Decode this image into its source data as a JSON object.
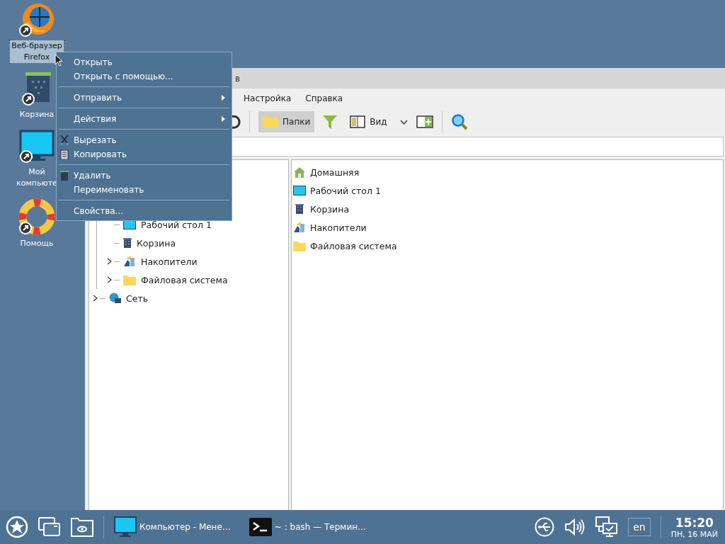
{
  "desktop_icons": [
    {
      "label": "Веб-браузер Firefox",
      "kind": "browser",
      "selected": true
    },
    {
      "label": "Корзина",
      "kind": "trash",
      "selected": false
    },
    {
      "label": "Мой компьюте",
      "kind": "computer",
      "selected": false
    },
    {
      "label": "Помощь",
      "kind": "help",
      "selected": false
    }
  ],
  "window": {
    "title": "в",
    "menu": [
      "Настройка",
      "Справка"
    ],
    "toolbar": [
      {
        "kind": "reload"
      },
      {
        "kind": "separator"
      },
      {
        "kind": "folders",
        "label": "Папки",
        "selected": true
      },
      {
        "kind": "filter"
      },
      {
        "kind": "view",
        "label": "Вид",
        "selected": false
      },
      {
        "kind": "dropdown"
      },
      {
        "kind": "split"
      },
      {
        "kind": "separator"
      },
      {
        "kind": "search"
      }
    ],
    "tree": [
      {
        "children": [
          {
            "label": "Рабочий стол 1",
            "kind": "desktop",
            "expandable": false
          },
          {
            "label": "Корзина",
            "kind": "trash",
            "expandable": false
          },
          {
            "label": "Накопители",
            "kind": "drives",
            "expandable": true
          },
          {
            "label": "Файловая система",
            "kind": "folder",
            "expandable": true
          }
        ]
      },
      {
        "label": "Сеть",
        "kind": "network",
        "expandable": true
      }
    ],
    "places": [
      {
        "label": "Домашняя",
        "kind": "home"
      },
      {
        "label": "Рабочий стол 1",
        "kind": "desktop"
      },
      {
        "label": "Корзина",
        "kind": "trash"
      },
      {
        "label": "Накопители",
        "kind": "drives"
      },
      {
        "label": "Файловая система",
        "kind": "folder"
      }
    ]
  },
  "context_menu": [
    {
      "kind": "item",
      "label": "Открыть"
    },
    {
      "kind": "item",
      "label": "Открыть с помощью..."
    },
    {
      "kind": "separator"
    },
    {
      "kind": "submenu",
      "label": "Отправить"
    },
    {
      "kind": "separator"
    },
    {
      "kind": "submenu",
      "label": "Действия"
    },
    {
      "kind": "separator"
    },
    {
      "kind": "cut",
      "label": "Вырезать"
    },
    {
      "kind": "copy",
      "label": "Копировать"
    },
    {
      "kind": "separator"
    },
    {
      "kind": "delete",
      "label": "Удалить"
    },
    {
      "kind": "item",
      "label": "Переименовать"
    },
    {
      "kind": "separator"
    },
    {
      "kind": "item",
      "label": "Свойства..."
    }
  ],
  "taskbar": {
    "launchers": [
      {
        "kind": "start"
      },
      {
        "kind": "windows"
      },
      {
        "kind": "folder-view"
      }
    ],
    "tasks": [
      {
        "label": "Компьютер - Мене…",
        "kind": "computer"
      },
      {
        "label": "~ : bash — Термин…",
        "kind": "terminal"
      }
    ],
    "tray": [
      {
        "kind": "usb"
      },
      {
        "kind": "volume"
      },
      {
        "kind": "network"
      }
    ],
    "layout": "en",
    "time": "15:20",
    "date": "ПН, 16 МАЙ"
  }
}
